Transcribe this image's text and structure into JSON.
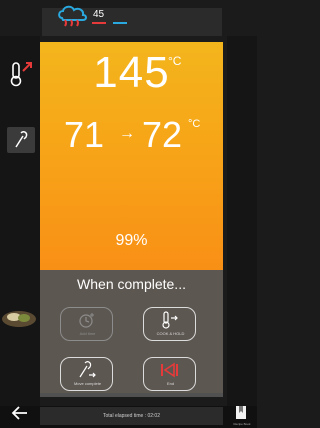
{
  "header": {
    "mode_icon": "steam-cloud-heat-icon",
    "tab_value": "45",
    "accent_red": "#e63a3a",
    "accent_blue": "#29a9e0"
  },
  "sidebar": {
    "thermo_icon": "thermometer-up-icon",
    "probe_icon": "probe-icon"
  },
  "main": {
    "cabinet_temp": "145",
    "cabinet_unit": "°C",
    "core_from": "71",
    "core_arrow": "→",
    "core_to": "72",
    "core_unit": "°C",
    "progress": "99%",
    "gradient_colors": [
      "#f3b51c",
      "#f98f16"
    ]
  },
  "complete": {
    "title": "When complete...",
    "actions": [
      {
        "label": "Add time",
        "icon": "add-time-icon",
        "enabled": false
      },
      {
        "label": "COOK & HOLD",
        "icon": "cook-hold-icon",
        "enabled": true
      },
      {
        "label": "Move complete",
        "icon": "probe-move-icon",
        "enabled": true
      },
      {
        "label": "End",
        "icon": "end-icon",
        "enabled": true
      }
    ]
  },
  "footer": {
    "elapsed_text": "Total elapsed time : 02:02",
    "back_icon": "back-arrow-icon",
    "book_icon": "book-icon",
    "book_label": "Recipe Book"
  }
}
